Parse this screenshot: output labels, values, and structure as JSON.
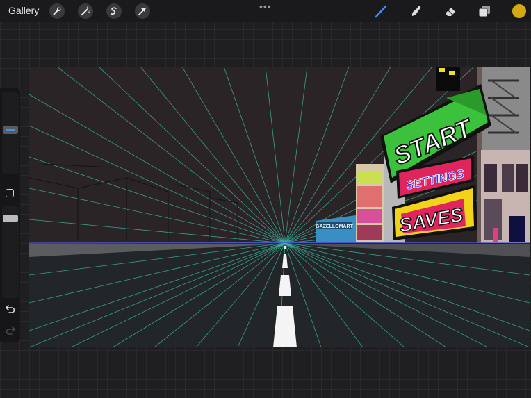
{
  "topbar": {
    "gallery_label": "Gallery",
    "more_label": "•••",
    "left_tools": [
      "wrench-icon",
      "magic-wand-icon",
      "selection-icon",
      "transform-arrow-icon"
    ],
    "right_tools": [
      "brush-icon",
      "smudge-icon",
      "eraser-icon",
      "layers-icon"
    ],
    "active_tool": "brush-icon",
    "accent_color": "#3c8ff0",
    "current_color": "#d4aa14"
  },
  "sidebar": {
    "items": [
      "brush-size-slider",
      "modify-button",
      "opacity-slider",
      "undo-icon",
      "redo-icon"
    ]
  },
  "canvas": {
    "menu": {
      "start": "START",
      "settings": "SETTINGS",
      "saves": "SAVES"
    },
    "store_sign": "GAZELLOMART",
    "colors": {
      "sky": "#2a2427",
      "road": "#222628",
      "guides": "#3ec9b0",
      "horizon": "#4a55c8",
      "start_green": "#3bc13b",
      "settings_pink": "#e0245e",
      "saves_yellow": "#f2d21b"
    }
  }
}
